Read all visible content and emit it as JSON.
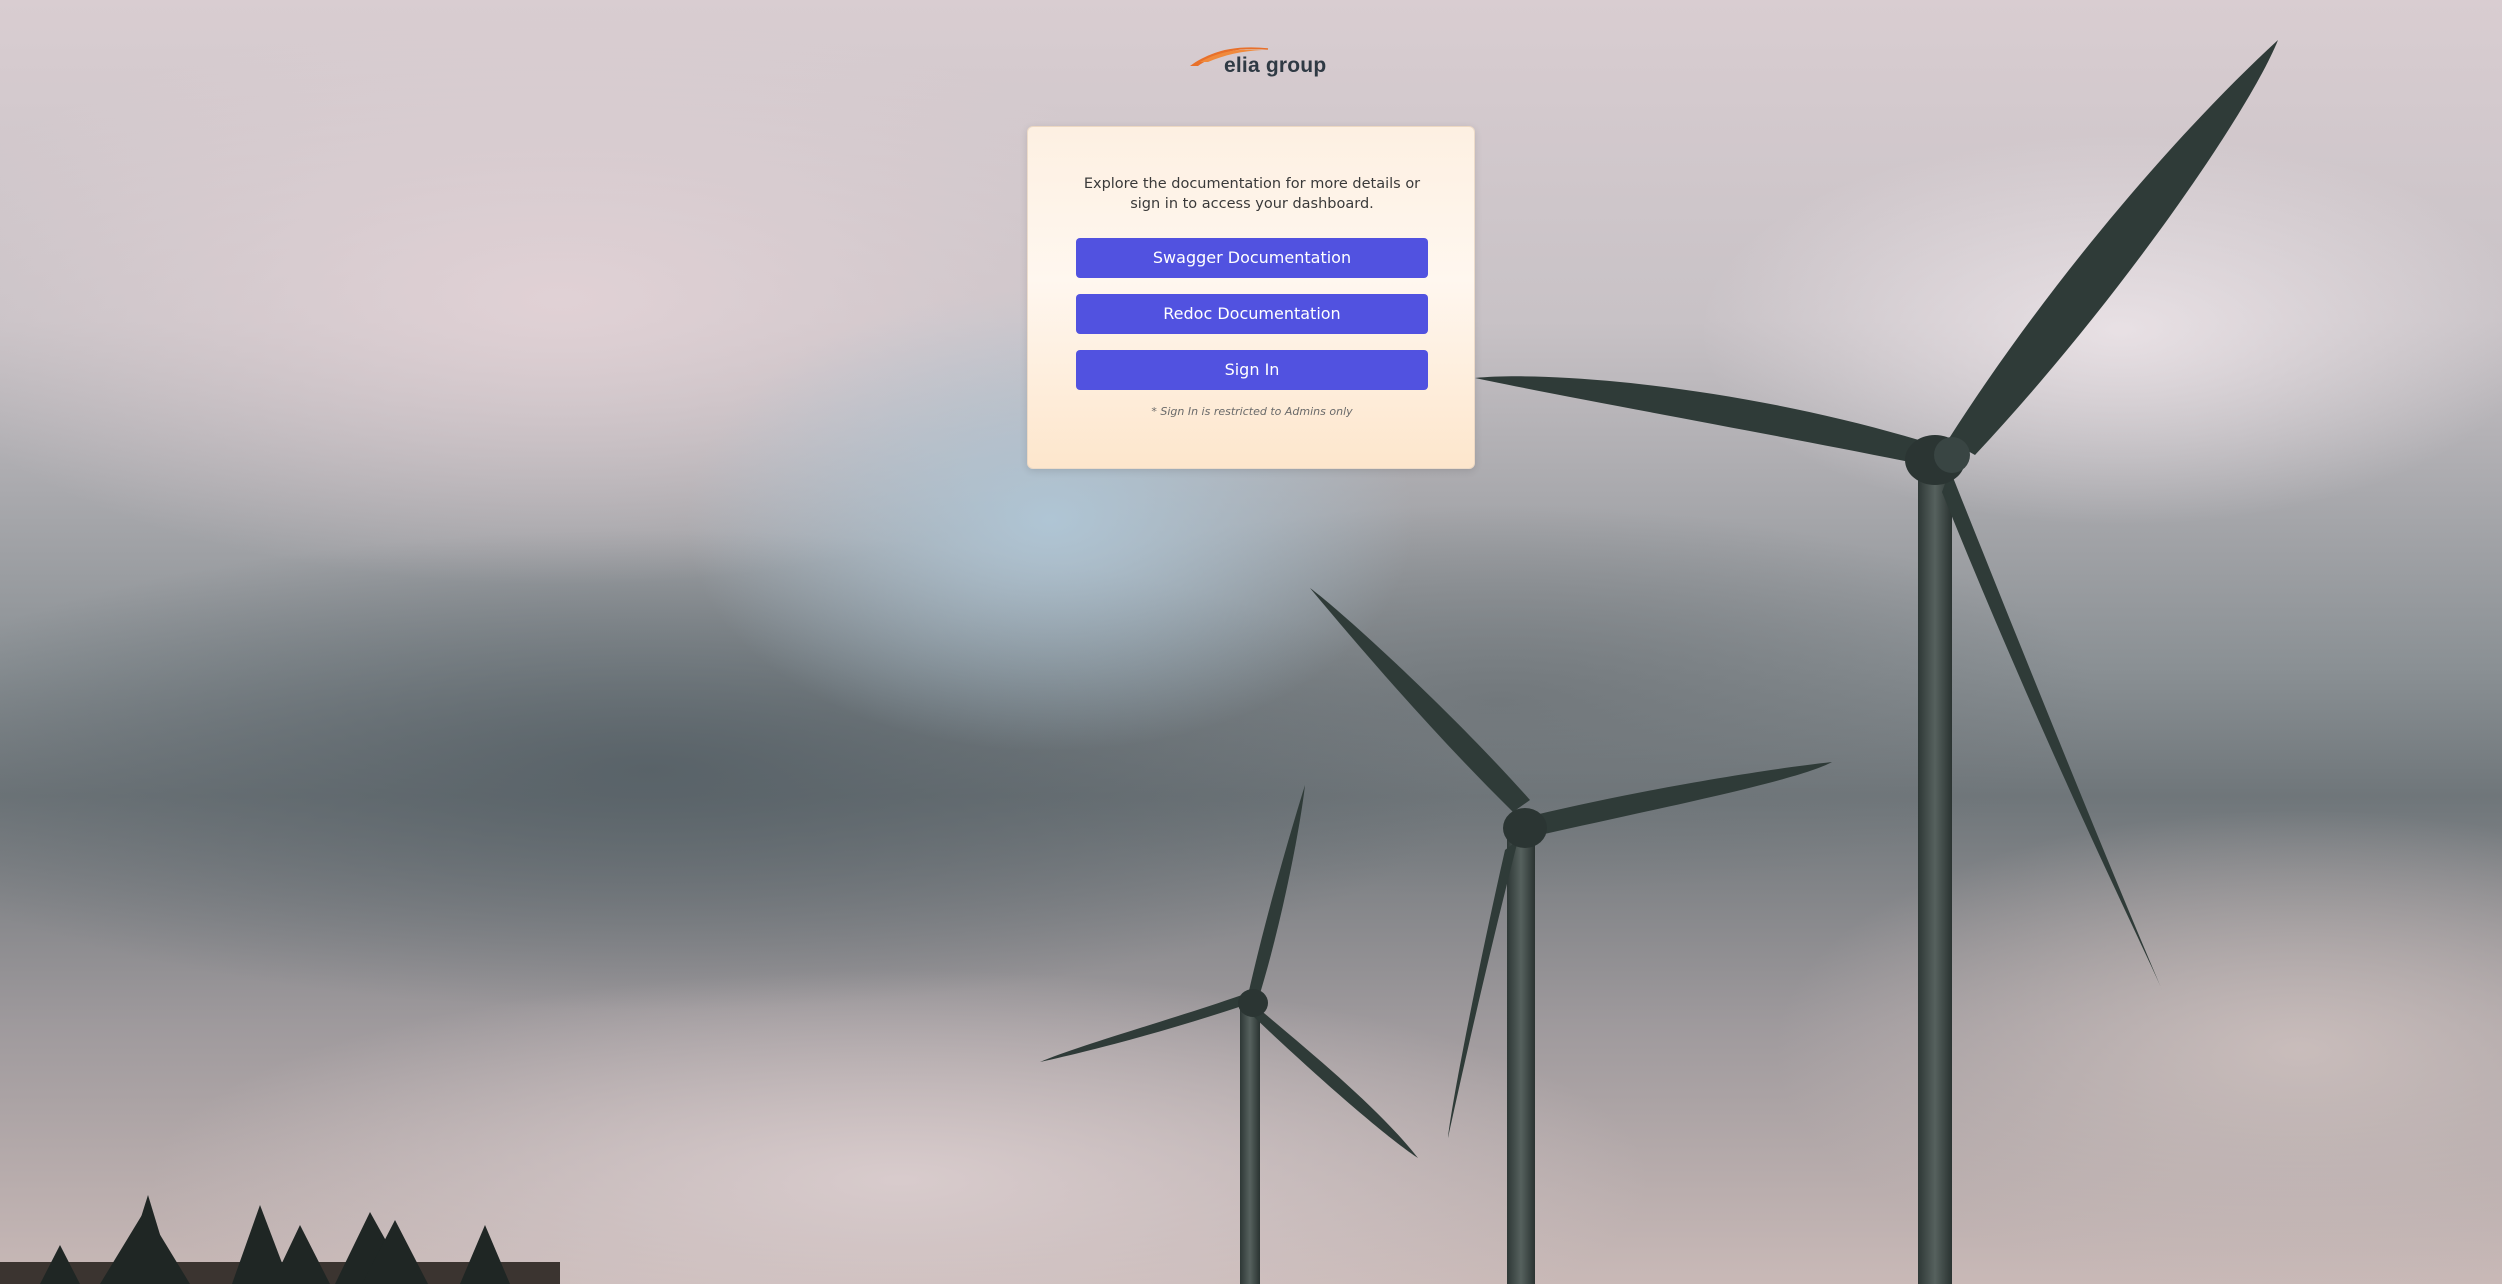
{
  "brand": {
    "logo_text": "elia group",
    "logo_color": "#2f3a44",
    "swoosh_color": "#e8702a"
  },
  "background": {
    "subject": "wind turbines against cloudy sky"
  },
  "card": {
    "description": "Explore the documentation for more details or sign in to access your dashboard.",
    "buttons": {
      "swagger_label": "Swagger Documentation",
      "redoc_label": "Redoc Documentation",
      "signin_label": "Sign In"
    },
    "note": "* Sign In is restricted to Admins only",
    "button_color": "#5152e0"
  }
}
